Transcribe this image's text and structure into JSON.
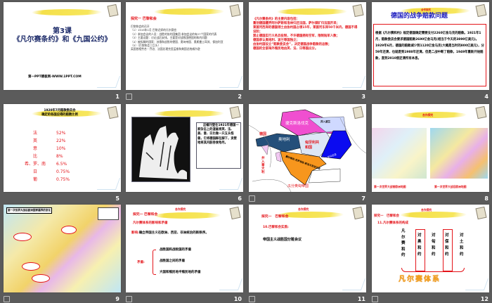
{
  "slides": [
    {
      "number": "1",
      "title_line1": "第3课",
      "title_line2": "《凡尔赛条约》和《九国公约》",
      "footer": "第一PPT模板网-WWW.1PPT.COM"
    },
    {
      "number": "2",
      "heading": "探究一 巴黎和会",
      "lines": [
        "巴黎和会的召开",
        "（1）1919年1月 巴黎近郊的凡尔赛宫",
        "（2）参加会议的人员：战胜的协约国集团 参加会议的有27个国家的代表",
        "（3）主要议题：讨论战后安排，主要是对战败国德国的和约问题",
        "（4）被拆解的国家：苏俄和战败的德国、奥匈帝国、奥斯曼土耳其、保加利亚",
        "（5）（巴黎和会三巨头）：",
        "英国首相劳合・乔治、法国总理克里孟梭和美国总统威尔逊"
      ]
    },
    {
      "number": "3",
      "lines": [
        "《凡尔赛条约》的主要内容包括：",
        "重划德国疆界阿尔萨斯和洛林归还法国，萨尔煤矿归法国开采；",
        "莱茵河西岸的德国领土由协约国占领15年，莱茵河东岸50千米内，德国不得设防；",
        "禁止德国实行义务兵役制，不许德国拥有空军，限制陆军人数；",
        "德国承认奥地利、波兰等国独立；",
        "由协约国设立“赔款委员会”，决定德国战争赔款的总数；",
        "德国的全部海外殖民地由英、法、日等国瓜分。"
      ]
    },
    {
      "number": "4",
      "kicker": "合作探究",
      "title": "德国的战争赔款问题",
      "body": "根据《凡尔赛和约》规定德国确定需要支付2260亿金马克的赔款。1921年1月，赔款委员会要求德国赔款2690亿金马克(相当于今天的3890亿美元)。1929年6月，德国的赔款减少到1120亿金马克(大概是当时的800亿美元)，分59年还清，也就是到1988年还清。但是二战中断了赔款，1949年重新开始赔款，直到2010偿还清所有本息。"
    },
    {
      "number": "5",
      "title_line1": "1920年7月赔款委员会",
      "title_line2": "确定的各国应得的赔款比例",
      "rows": [
        {
          "country": "法",
          "share": "52%"
        },
        {
          "country": "英",
          "share": "22%"
        },
        {
          "country": "意",
          "share": "10%"
        },
        {
          "country": "比",
          "share": "8%"
        },
        {
          "country": "希、罗、南",
          "share": "6.5%"
        },
        {
          "country": "日",
          "share": "0.75%"
        },
        {
          "country": "葡",
          "share": "0.75%"
        }
      ]
    },
    {
      "number": "6",
      "caption": "这幅刊登在1921年德国一家杂志上的漫画将英、法、美、意、日比做一只五头怪兽，它将德国踩在脚下，贪婪地将其内脏吞食殆尽。"
    },
    {
      "number": "7",
      "labels": {
        "czech": "捷克斯洛伐克",
        "poland": "并入波兰",
        "germany": "德国",
        "austria": "奥地利",
        "hungary": "匈牙利共和国",
        "romania": "并入罗马尼亚",
        "serbia": "塞尔维亚-克罗地亚-斯洛文尼亚王国",
        "italy": "并入意大利",
        "caption": "瓜分奥匈帝国"
      }
    },
    {
      "number": "8",
      "kicker": "合作探究",
      "caption_left": "第一次世界大战前欧洲地图",
      "caption_right": "第一次世界大战后欧洲地图"
    },
    {
      "number": "9",
      "title": "第一次世界大战后欧洲国家疆界的变化"
    },
    {
      "number": "10",
      "kicker": "合作探究",
      "heading": "探究一 巴黎和会",
      "sub": "凡尔赛体系的影响和矛盾",
      "impact_label": "影响:",
      "impact": "确立帝国主义在欧洲、西亚、非洲统治的新秩序。",
      "conflict_label": "矛盾:",
      "conflicts": [
        "战胜国和战败国的矛盾",
        "战胜国之间的矛盾",
        "大国和殖民地半殖民地的矛盾"
      ]
    },
    {
      "number": "11",
      "kicker": "合作探究",
      "heading": "探究一　巴黎和会",
      "sub": "10.巴黎和会实质:",
      "body": "帝国主义战胜国分赃会议"
    },
    {
      "number": "12",
      "kicker": "合作探究",
      "heading": "探究一　巴黎和会",
      "sub": "11.凡尔赛体系的构成",
      "treaties": [
        "凡尔赛和约",
        "对奥和约",
        "对匈和约",
        "对保和约",
        "对土和约"
      ],
      "system": "凡尔赛体系"
    }
  ],
  "colors": {
    "background": "#5b5b5b",
    "red": "#e4141a",
    "navy": "#1f2d6b",
    "brush": "#f4e04a"
  }
}
